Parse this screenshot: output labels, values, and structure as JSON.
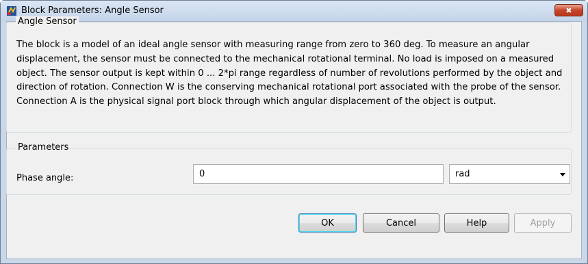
{
  "window": {
    "title": "Block Parameters: Angle Sensor",
    "close_glyph": "✖",
    "title_icon": "simulink-block-icon"
  },
  "block": {
    "name": "Angle Sensor",
    "description": "The block is a model of an ideal angle sensor with measuring range from zero to 360 deg. To measure an angular displacement, the sensor must be connected to the mechanical rotational terminal. No load is imposed on a measured object. The sensor output is kept within 0 ... 2*pi range regardless of number of revolutions performed by the object and direction of rotation. Connection W is the conserving  mechanical rotational port associated with the probe of the sensor. Connection A is the physical signal port block through which angular displacement of the object is output."
  },
  "parameters": {
    "section_label": "Parameters",
    "phase_angle": {
      "label": "Phase angle:",
      "value": "0",
      "unit": "rad"
    }
  },
  "buttons": {
    "ok": "OK",
    "cancel": "Cancel",
    "help": "Help",
    "apply": "Apply"
  },
  "colors": {
    "close_button": "#c7452a",
    "default_button_border": "#3c7fb1"
  }
}
